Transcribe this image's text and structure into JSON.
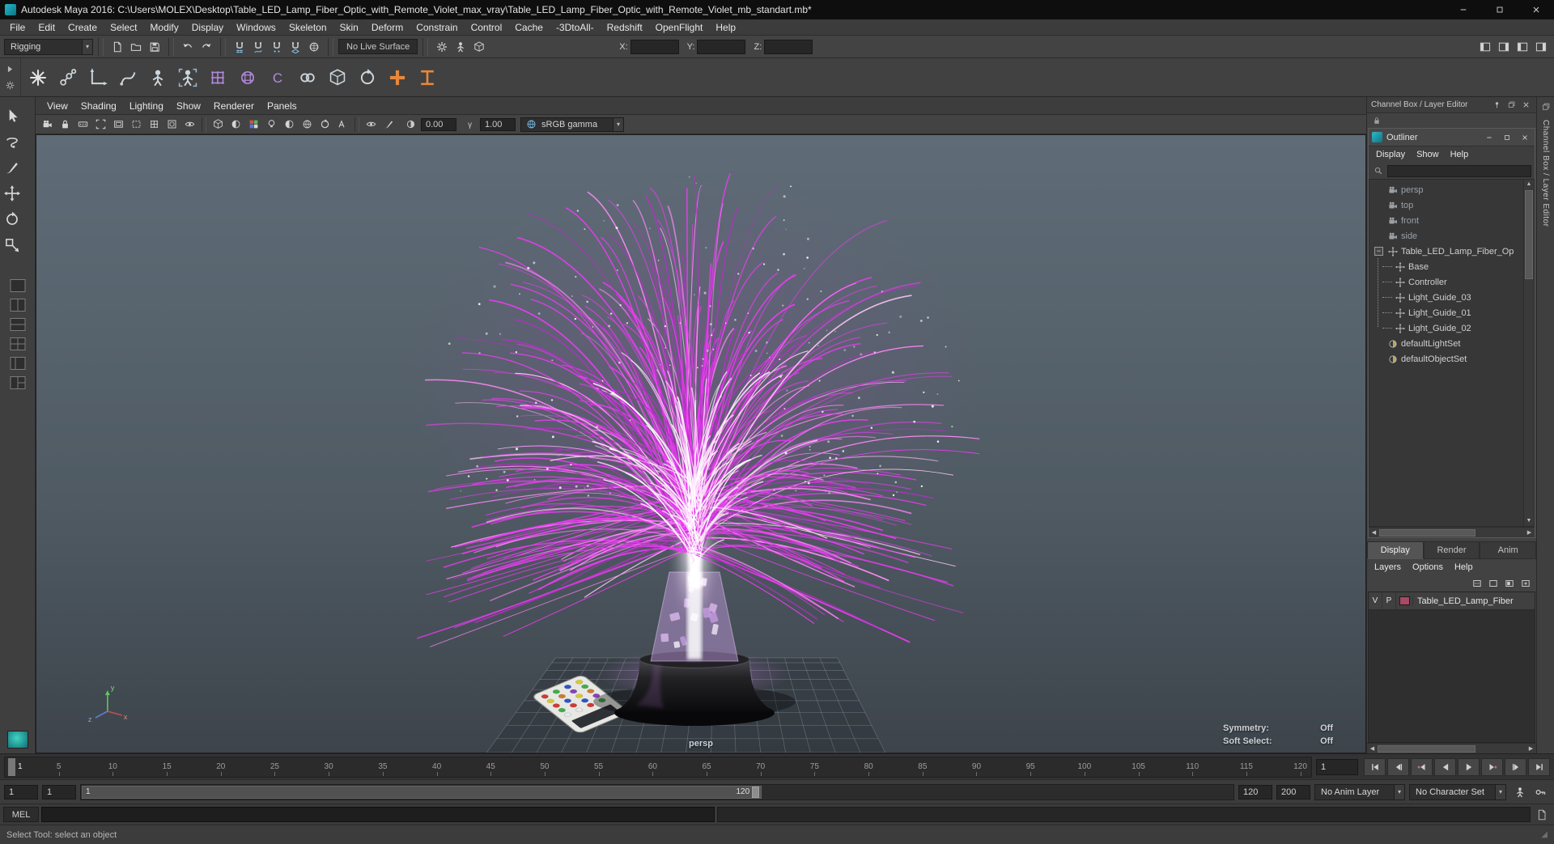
{
  "window": {
    "title": "Autodesk Maya 2016: C:\\Users\\MOLEX\\Desktop\\Table_LED_Lamp_Fiber_Optic_with_Remote_Violet_max_vray\\Table_LED_Lamp_Fiber_Optic_with_Remote_Violet_mb_standart.mb*"
  },
  "menubar": {
    "items": [
      "File",
      "Edit",
      "Create",
      "Select",
      "Modify",
      "Display",
      "Windows",
      "Skeleton",
      "Skin",
      "Deform",
      "Constrain",
      "Control",
      "Cache",
      "-3DtoAll-",
      "Redshift",
      "OpenFlight",
      "Help"
    ]
  },
  "statusline": {
    "menuset": "Rigging",
    "no_live_surface": "No Live Surface",
    "x_label": "X:",
    "y_label": "Y:",
    "z_label": "Z:",
    "icons": {
      "file": [
        [
          "new-scene",
          "page"
        ],
        [
          "open-scene",
          "folder"
        ],
        [
          "save-scene",
          "disk"
        ]
      ],
      "undo": [
        [
          "undo",
          "undo"
        ],
        [
          "redo",
          "redo"
        ]
      ],
      "snap": [
        [
          "snap-to-grid",
          "magnetgrid"
        ],
        [
          "snap-to-curve",
          "magnetcurve"
        ],
        [
          "snap-to-point",
          "magnetpoint"
        ],
        [
          "snap-to-plane",
          "magnetplane"
        ],
        [
          "make-live",
          "livesphere"
        ]
      ],
      "hist": [
        [
          "construction-history",
          "gear"
        ],
        [
          "select-hierarchy",
          "person"
        ],
        [
          "select-object",
          "cube"
        ]
      ],
      "right": [
        [
          "raise-ui-elements",
          "panelL"
        ],
        [
          "attribute-editor",
          "panelR"
        ],
        [
          "tool-settings",
          "panelL"
        ],
        [
          "channel-box",
          "panelR"
        ]
      ]
    }
  },
  "shelf": {
    "icons": [
      [
        "create-node",
        "star",
        "#e2e2e2"
      ],
      [
        "joint-tool",
        "joint",
        "#ccd6dc"
      ],
      [
        "ik-handle-tool",
        "anglearrow",
        "#ccd6dc"
      ],
      [
        "insert-joint-tool",
        "curvehook",
        "#ccd6dc"
      ],
      [
        "skeleton-hik",
        "person",
        "#ccd6dc"
      ],
      [
        "quick-rig",
        "personbox",
        "#ccd6dc"
      ],
      [
        "create-lattice",
        "lattice",
        "#b48ae0"
      ],
      [
        "lattice-sphere",
        "latticesphere",
        "#b48ae0"
      ],
      [
        "create-cluster",
        "cluster",
        "#b48ae0"
      ],
      [
        "parent-constraint",
        "chain",
        "#ccd6dc"
      ],
      [
        "point-constraint",
        "cube",
        "#ccd6dc"
      ],
      [
        "orient-constraint",
        "rotate",
        "#ccd6dc"
      ],
      [
        "add-attribute",
        "plus",
        "#e8873c"
      ],
      [
        "edit-membership",
        "bracket",
        "#e8873c"
      ]
    ]
  },
  "toolbox": {
    "tools": [
      [
        "select-tool",
        "cursor"
      ],
      [
        "lasso-tool",
        "lasso"
      ],
      [
        "paint-select-tool",
        "brush"
      ],
      [
        "move-tool",
        "move"
      ],
      [
        "rotate-tool",
        "rotate"
      ],
      [
        "scale-tool",
        "scale"
      ]
    ],
    "layouts": [
      "layout-single",
      "layout-two-side",
      "layout-two-stacked",
      "layout-three-split",
      "layout-four",
      "layout-outliner-persp"
    ]
  },
  "viewport": {
    "menus": [
      "View",
      "Shading",
      "Lighting",
      "Show",
      "Renderer",
      "Panels"
    ],
    "toolbar": {
      "g1": [
        [
          "select-camera",
          "cameraicon"
        ],
        [
          "lock-camera",
          "lock"
        ],
        [
          "camera-attributes",
          "film"
        ],
        [
          "film-gate",
          "gate"
        ],
        [
          "resolution-gate",
          "resgate"
        ],
        [
          "gate-mask",
          "region"
        ],
        [
          "field-chart",
          "lattice"
        ],
        [
          "safe-action",
          "xray"
        ],
        [
          "safe-title",
          "eye"
        ]
      ],
      "g2": [
        [
          "wireframe",
          "cube"
        ],
        [
          "shaded-display",
          "shadowball"
        ],
        [
          "textured-display",
          "rgba"
        ],
        [
          "use-all-lights",
          "bulb"
        ],
        [
          "shadows",
          "shadowball"
        ],
        [
          "screen-space-ao",
          "colorsphere"
        ],
        [
          "motion-blur",
          "rotate"
        ],
        [
          "multisample-aa",
          "aaicon"
        ]
      ],
      "g3": [
        [
          "isolate-select",
          "eye"
        ],
        [
          "grease-pencil",
          "brush"
        ]
      ]
    },
    "exposure": "0.00",
    "gamma": "1.00",
    "view_transform": "sRGB gamma",
    "camera": "persp",
    "symmetry_label": "Symmetry:",
    "symmetry_value": "Off",
    "soft_select_label": "Soft Select:",
    "soft_select_value": "Off"
  },
  "right": {
    "dock_title": "Channel Box / Layer Editor",
    "vertical_tab": "Channel Box / Layer Editor",
    "outliner": {
      "title": "Outliner",
      "menus": [
        "Display",
        "Show",
        "Help"
      ],
      "cameras": [
        "persp",
        "top",
        "front",
        "side"
      ],
      "root": "Table_LED_Lamp_Fiber_Op",
      "children": [
        "Base",
        "Controller",
        "Light_Guide_03",
        "Light_Guide_01",
        "Light_Guide_02"
      ],
      "sets": [
        "defaultLightSet",
        "defaultObjectSet"
      ]
    },
    "layers": {
      "tabs": [
        "Display",
        "Render",
        "Anim"
      ],
      "active_tab": "Display",
      "menus": [
        "Layers",
        "Options",
        "Help"
      ],
      "icons": [
        [
          "layer-options",
          "layeropts"
        ],
        [
          "new-empty-layer",
          "layerempty"
        ],
        [
          "new-layer-from-selected",
          "layersel"
        ],
        [
          "new-layer",
          "layernew"
        ]
      ],
      "row": {
        "visible": "V",
        "playback": "P",
        "color": "#a84a66",
        "name": "Table_LED_Lamp_Fiber"
      }
    }
  },
  "timeline": {
    "current": "1",
    "current_field": "1",
    "ticks": [
      "5",
      "10",
      "15",
      "20",
      "25",
      "30",
      "35",
      "40",
      "45",
      "50",
      "55",
      "60",
      "65",
      "70",
      "75",
      "80",
      "85",
      "90",
      "95",
      "100",
      "105",
      "110",
      "115",
      "120"
    ],
    "transport": [
      [
        "go-to-start",
        "trstart"
      ],
      [
        "step-back-frame",
        "trstepb"
      ],
      [
        "step-back-key",
        "trkeyb"
      ],
      [
        "play-backwards",
        "trplayb"
      ],
      [
        "play-forwards",
        "trplayf"
      ],
      [
        "step-forward-key",
        "trkeyf"
      ],
      [
        "step-forward-frame",
        "trstepf"
      ],
      [
        "go-to-end",
        "trend"
      ]
    ]
  },
  "range": {
    "playback_start": "1",
    "anim_start": "1",
    "handle_start": "1",
    "handle_end": "120",
    "playback_end": "120",
    "anim_end": "200",
    "anim_layer": "No Anim Layer",
    "character_set": "No Character Set",
    "icons": [
      [
        "character-set-menu",
        "person"
      ],
      [
        "auto-keyframe",
        "keyicon"
      ]
    ]
  },
  "command": {
    "label": "MEL"
  },
  "help": {
    "text": "Select Tool: select an object"
  },
  "colors": {
    "fiber_main": "#ea3cf2",
    "fiber_dark": "#bb2ccc",
    "fiber_light": "#ff8af8",
    "fiber_pale": "#ffc9f6",
    "glow": "#d882f0"
  }
}
